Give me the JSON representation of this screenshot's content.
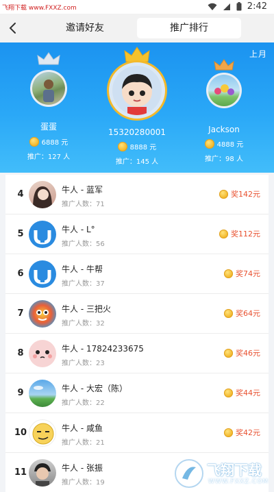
{
  "status_bar": {
    "watermark": "飞翔下载 www.FXXZ.com",
    "time": "2:42"
  },
  "nav": {
    "tabs": [
      {
        "label": "邀请好友"
      },
      {
        "label": "推广排行"
      }
    ]
  },
  "podium": {
    "period": "上月",
    "first": {
      "name": "15320280001",
      "coins": "8888 元",
      "promo": "推广：145 人"
    },
    "second": {
      "name": "蛋蛋",
      "coins": "6888 元",
      "promo": "推广：127 人"
    },
    "third": {
      "name": "Jackson",
      "coins": "4888 元",
      "promo": "推广：98 人"
    }
  },
  "rankings": [
    {
      "rank": "4",
      "name": "牛人 - 蓝军",
      "count": "推广人数：71",
      "reward": "奖142元"
    },
    {
      "rank": "5",
      "name": "牛人 - L°",
      "count": "推广人数：56",
      "reward": "奖112元"
    },
    {
      "rank": "6",
      "name": "牛人 - 牛帮",
      "count": "推广人数：37",
      "reward": "奖74元"
    },
    {
      "rank": "7",
      "name": "牛人 - 三把火",
      "count": "推广人数：32",
      "reward": "奖64元"
    },
    {
      "rank": "8",
      "name": "牛人 - 17824233675",
      "count": "推广人数：23",
      "reward": "奖46元"
    },
    {
      "rank": "9",
      "name": "牛人 - 大宏（陈）",
      "count": "推广人数：22",
      "reward": "奖44元"
    },
    {
      "rank": "10",
      "name": "牛人 - 咸鱼",
      "count": "推广人数：21",
      "reward": "奖42元"
    },
    {
      "rank": "11",
      "name": "牛人 - 张振",
      "count": "推广人数：19",
      "reward": ""
    }
  ],
  "watermark_logo": {
    "brand": "飞翔下载",
    "url": "WWW.FXXZ.COM"
  }
}
